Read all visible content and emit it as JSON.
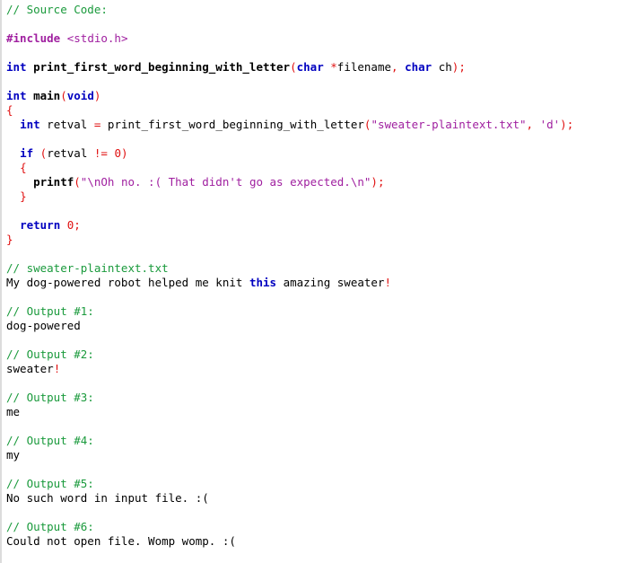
{
  "document": {
    "title": "Source Code:",
    "background_color": "#ffffff",
    "gutter_color": "#dcdcdc",
    "palette": {
      "comment": "#1a9a3c",
      "keyword": "#0000c0",
      "preprocessor": "#a020a0",
      "string": "#a020a0",
      "punctuation": "#e01010",
      "plain": "#000000"
    }
  },
  "lines": [
    {
      "tokens": [
        {
          "t": "// Source Code:",
          "c": "comment"
        }
      ]
    },
    {
      "tokens": []
    },
    {
      "tokens": [
        {
          "t": "#include",
          "c": "preproc"
        },
        {
          "t": " ",
          "c": "plain"
        },
        {
          "t": "<stdio.h>",
          "c": "header"
        }
      ]
    },
    {
      "tokens": []
    },
    {
      "tokens": [
        {
          "t": "int",
          "c": "keyword"
        },
        {
          "t": " ",
          "c": "plain"
        },
        {
          "t": "print_first_word_beginning_with_letter",
          "c": "func"
        },
        {
          "t": "(",
          "c": "punct"
        },
        {
          "t": "char",
          "c": "keyword"
        },
        {
          "t": " ",
          "c": "plain"
        },
        {
          "t": "*",
          "c": "punct"
        },
        {
          "t": "filename",
          "c": "plain"
        },
        {
          "t": ",",
          "c": "punct"
        },
        {
          "t": " ",
          "c": "plain"
        },
        {
          "t": "char",
          "c": "keyword"
        },
        {
          "t": " ",
          "c": "plain"
        },
        {
          "t": "ch",
          "c": "plain"
        },
        {
          "t": ")",
          "c": "punct"
        },
        {
          "t": ";",
          "c": "punct"
        }
      ]
    },
    {
      "tokens": []
    },
    {
      "tokens": [
        {
          "t": "int",
          "c": "keyword"
        },
        {
          "t": " ",
          "c": "plain"
        },
        {
          "t": "main",
          "c": "func"
        },
        {
          "t": "(",
          "c": "punct"
        },
        {
          "t": "void",
          "c": "keyword"
        },
        {
          "t": ")",
          "c": "punct"
        }
      ]
    },
    {
      "tokens": [
        {
          "t": "{",
          "c": "punct"
        }
      ]
    },
    {
      "tokens": [
        {
          "t": "  ",
          "c": "plain"
        },
        {
          "t": "int",
          "c": "keyword"
        },
        {
          "t": " ",
          "c": "plain"
        },
        {
          "t": "retval",
          "c": "plain"
        },
        {
          "t": " ",
          "c": "plain"
        },
        {
          "t": "=",
          "c": "punct"
        },
        {
          "t": " ",
          "c": "plain"
        },
        {
          "t": "print_first_word_beginning_with_letter",
          "c": "call"
        },
        {
          "t": "(",
          "c": "punct"
        },
        {
          "t": "\"sweater-plaintext.txt\"",
          "c": "string"
        },
        {
          "t": ",",
          "c": "punct"
        },
        {
          "t": " ",
          "c": "plain"
        },
        {
          "t": "'d'",
          "c": "string"
        },
        {
          "t": ")",
          "c": "punct"
        },
        {
          "t": ";",
          "c": "punct"
        }
      ]
    },
    {
      "tokens": []
    },
    {
      "tokens": [
        {
          "t": "  ",
          "c": "plain"
        },
        {
          "t": "if",
          "c": "keyword"
        },
        {
          "t": " ",
          "c": "plain"
        },
        {
          "t": "(",
          "c": "punct"
        },
        {
          "t": "retval",
          "c": "plain"
        },
        {
          "t": " ",
          "c": "plain"
        },
        {
          "t": "!=",
          "c": "punct"
        },
        {
          "t": " ",
          "c": "plain"
        },
        {
          "t": "0",
          "c": "number"
        },
        {
          "t": ")",
          "c": "punct"
        }
      ]
    },
    {
      "tokens": [
        {
          "t": "  ",
          "c": "plain"
        },
        {
          "t": "{",
          "c": "punct"
        }
      ]
    },
    {
      "tokens": [
        {
          "t": "    ",
          "c": "plain"
        },
        {
          "t": "printf",
          "c": "func"
        },
        {
          "t": "(",
          "c": "punct"
        },
        {
          "t": "\"\\nOh no. :( That didn't go as expected.\\n\"",
          "c": "string"
        },
        {
          "t": ")",
          "c": "punct"
        },
        {
          "t": ";",
          "c": "punct"
        }
      ]
    },
    {
      "tokens": [
        {
          "t": "  ",
          "c": "plain"
        },
        {
          "t": "}",
          "c": "punct"
        }
      ]
    },
    {
      "tokens": []
    },
    {
      "tokens": [
        {
          "t": "  ",
          "c": "plain"
        },
        {
          "t": "return",
          "c": "keyword"
        },
        {
          "t": " ",
          "c": "plain"
        },
        {
          "t": "0",
          "c": "number"
        },
        {
          "t": ";",
          "c": "punct"
        }
      ]
    },
    {
      "tokens": [
        {
          "t": "}",
          "c": "punct"
        }
      ]
    },
    {
      "tokens": []
    },
    {
      "tokens": [
        {
          "t": "// sweater-plaintext.txt",
          "c": "comment"
        }
      ]
    },
    {
      "tokens": [
        {
          "t": "My dog-powered robot helped me knit ",
          "c": "plain"
        },
        {
          "t": "this",
          "c": "keyword"
        },
        {
          "t": " amazing sweater",
          "c": "plain"
        },
        {
          "t": "!",
          "c": "punct"
        }
      ]
    },
    {
      "tokens": []
    },
    {
      "tokens": [
        {
          "t": "// Output #1:",
          "c": "comment"
        }
      ]
    },
    {
      "tokens": [
        {
          "t": "dog-powered",
          "c": "plain"
        }
      ]
    },
    {
      "tokens": []
    },
    {
      "tokens": [
        {
          "t": "// Output #2:",
          "c": "comment"
        }
      ]
    },
    {
      "tokens": [
        {
          "t": "sweater",
          "c": "plain"
        },
        {
          "t": "!",
          "c": "punct"
        }
      ]
    },
    {
      "tokens": []
    },
    {
      "tokens": [
        {
          "t": "// Output #3:",
          "c": "comment"
        }
      ]
    },
    {
      "tokens": [
        {
          "t": "me",
          "c": "plain"
        }
      ]
    },
    {
      "tokens": []
    },
    {
      "tokens": [
        {
          "t": "// Output #4:",
          "c": "comment"
        }
      ]
    },
    {
      "tokens": [
        {
          "t": "my",
          "c": "plain"
        }
      ]
    },
    {
      "tokens": []
    },
    {
      "tokens": [
        {
          "t": "// Output #5:",
          "c": "comment"
        }
      ]
    },
    {
      "tokens": [
        {
          "t": "No such word in input file. :(",
          "c": "plain"
        }
      ]
    },
    {
      "tokens": []
    },
    {
      "tokens": [
        {
          "t": "// Output #6:",
          "c": "comment"
        }
      ]
    },
    {
      "tokens": [
        {
          "t": "Could not open file. Womp womp. :(",
          "c": "plain"
        }
      ]
    }
  ]
}
